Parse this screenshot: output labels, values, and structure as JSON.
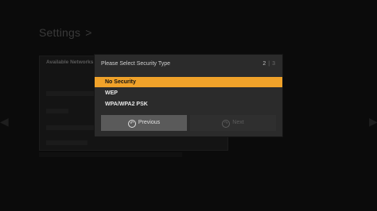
{
  "background": {
    "title": "Settings",
    "title_separator": ">",
    "panel_header": "Available Networks"
  },
  "dialog": {
    "title": "Please Select Security Type",
    "pager": {
      "current": "2",
      "separator": "|",
      "total": "3"
    },
    "options": [
      {
        "label": "No Security",
        "selected": true
      },
      {
        "label": "WEP",
        "selected": false
      },
      {
        "label": "WPA/WPA2 PSK",
        "selected": false
      }
    ],
    "buttons": {
      "previous": {
        "label": "Previous",
        "icon": "back-icon",
        "enabled": true
      },
      "next": {
        "label": "Next",
        "icon": "forward-icon",
        "enabled": false
      }
    }
  },
  "colors": {
    "accent": "#f0a22a",
    "dialog_bg": "#2b2b2b",
    "button_active": "#5a5a5a"
  }
}
